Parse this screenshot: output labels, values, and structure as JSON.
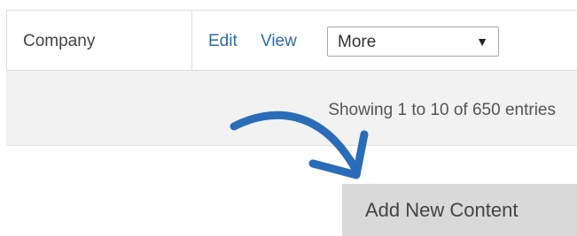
{
  "table": {
    "row": {
      "type_label": "Company",
      "actions": {
        "edit_label": "Edit",
        "view_label": "View",
        "more_select": {
          "selected": "More",
          "arrow_glyph": "▼"
        }
      }
    },
    "entries_info": "Showing 1 to 10 of 650 entries"
  },
  "add_button": {
    "label": "Add New Content"
  },
  "colors": {
    "link": "#2a6db0",
    "annotation_arrow": "#2b6cb8",
    "footer_band": "#f2f2f2",
    "button_bg": "#d9d9d9"
  },
  "icons": {
    "annotation": "curved-arrow-icon",
    "select_arrow": "triangle-down-icon"
  }
}
